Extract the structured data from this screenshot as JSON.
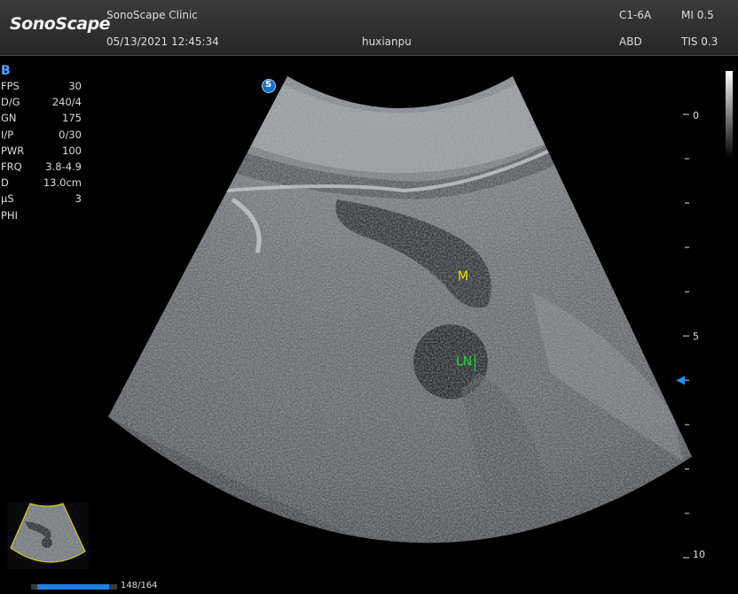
{
  "header": {
    "logo": "SonoScape",
    "clinic": "SonoScape Clinic",
    "datetime": "05/13/2021 12:45:34",
    "operator": "huxianpu",
    "probe": "C1-6A",
    "preset": "ABD",
    "mi": "MI 0.5",
    "tis": "TIS 0.3"
  },
  "params": {
    "mode": "B",
    "rows": [
      {
        "key": "FPS",
        "value": "30"
      },
      {
        "key": "D/G",
        "value": "240/4"
      },
      {
        "key": "GN",
        "value": "175"
      },
      {
        "key": "I/P",
        "value": "0/30"
      },
      {
        "key": "PWR",
        "value": "100"
      },
      {
        "key": "FRQ",
        "value": "3.8-4.9"
      },
      {
        "key": "D",
        "value": "13.0cm"
      },
      {
        "key": "µS",
        "value": "3"
      },
      {
        "key": "PHI",
        "value": ""
      }
    ]
  },
  "annotations": {
    "m_label": "M",
    "ln_label": "LN"
  },
  "depth_scale": {
    "labels": [
      "0",
      "5",
      "10"
    ]
  },
  "orientation_marker": "S",
  "cine": {
    "counter": "148/164",
    "current": 148,
    "total": 164
  },
  "colors": {
    "mode_label": "#4aa3ff",
    "annotation_m": "#e6e000",
    "annotation_ln": "#22d83a",
    "focus_marker": "#1e8fff",
    "cine_fill": "#1e7ee6"
  }
}
